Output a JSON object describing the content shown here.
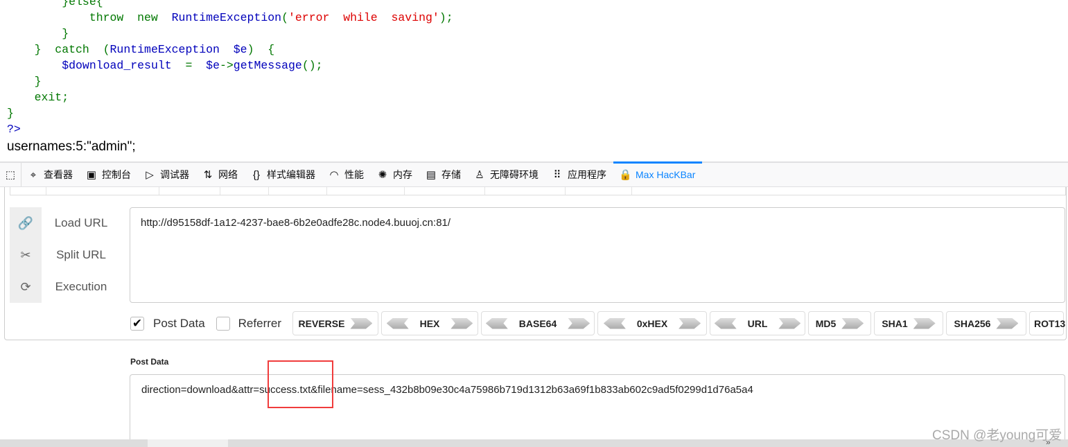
{
  "code_lines": [
    [
      {
        "t": "        }else{",
        "c": "g"
      }
    ],
    [
      {
        "t": "            throw  new  ",
        "c": "g"
      },
      {
        "t": "RuntimeException",
        "c": "b"
      },
      {
        "t": "(",
        "c": "g"
      },
      {
        "t": "'error  while  saving'",
        "c": "r"
      },
      {
        "t": ");",
        "c": "g"
      }
    ],
    [
      {
        "t": "        }",
        "c": "g"
      }
    ],
    [
      {
        "t": "    }  catch  (",
        "c": "g"
      },
      {
        "t": "RuntimeException  $e",
        "c": "b"
      },
      {
        "t": ")  {",
        "c": "g"
      }
    ],
    [
      {
        "t": "        ",
        "c": "g"
      },
      {
        "t": "$download_result",
        "c": "b"
      },
      {
        "t": "  =  ",
        "c": "g"
      },
      {
        "t": "$e",
        "c": "b"
      },
      {
        "t": "->",
        "c": "g"
      },
      {
        "t": "getMessage",
        "c": "b"
      },
      {
        "t": "();",
        "c": "g"
      }
    ],
    [
      {
        "t": "    }",
        "c": "g"
      }
    ],
    [
      {
        "t": "    exit;",
        "c": "g"
      }
    ],
    [
      {
        "t": "}",
        "c": "g"
      }
    ],
    [
      {
        "t": "?>",
        "c": "b"
      }
    ]
  ],
  "output_text": "usernames:5:\"admin\";",
  "devtools": {
    "tabs": [
      {
        "icon": "inspector-icon",
        "glyph": "⌖",
        "label": "查看器"
      },
      {
        "icon": "console-icon",
        "glyph": "▣",
        "label": "控制台"
      },
      {
        "icon": "debugger-icon",
        "glyph": "▷",
        "label": "调试器"
      },
      {
        "icon": "network-icon",
        "glyph": "⇅",
        "label": "网络"
      },
      {
        "icon": "style-editor-icon",
        "glyph": "{}",
        "label": "样式编辑器"
      },
      {
        "icon": "performance-icon",
        "glyph": "◠",
        "label": "性能"
      },
      {
        "icon": "memory-icon",
        "glyph": "✺",
        "label": "内存"
      },
      {
        "icon": "storage-icon",
        "glyph": "▤",
        "label": "存储"
      },
      {
        "icon": "accessibility-icon",
        "glyph": "♙",
        "label": "无障碍环境"
      },
      {
        "icon": "application-icon",
        "glyph": "⠿",
        "label": "应用程序"
      },
      {
        "icon": "hackbar-icon",
        "glyph": "🔒",
        "label": "Max HacKBar",
        "active": true
      }
    ]
  },
  "hackbar": {
    "actions": [
      {
        "icon": "link-icon",
        "glyph": "🔗",
        "label": "Load URL"
      },
      {
        "icon": "scissors-icon",
        "glyph": "✂",
        "label": "Split URL"
      },
      {
        "icon": "refresh-icon",
        "glyph": "⟳",
        "label": "Execution"
      }
    ],
    "url": "http://d95158df-1a12-4237-bae8-6b2e0adfe28c.node4.buuoj.cn:81/",
    "post_data_checkbox": {
      "label": "Post Data",
      "checked": true
    },
    "referrer_checkbox": {
      "label": "Referrer",
      "checked": false
    },
    "buttons": [
      {
        "label": "REVERSE",
        "left": false
      },
      {
        "label": "HEX",
        "left": true
      },
      {
        "label": "BASE64",
        "left": true
      },
      {
        "label": "0xHEX",
        "left": true
      },
      {
        "label": "URL",
        "left": true
      },
      {
        "label": "MD5",
        "left": false
      },
      {
        "label": "SHA1",
        "left": false
      },
      {
        "label": "SHA256",
        "left": false
      },
      {
        "label": "ROT13",
        "left": false
      }
    ],
    "post_data_label": "Post Data",
    "post_data": "direction=download&attr=success.txt&filename=sess_432b8b09e30c4a75986b719d1312b63a69f1b833ab602c9ad5f0299d1d76a5a4"
  },
  "watermark": "CSDN @老young可爱",
  "scroll_more": "»"
}
